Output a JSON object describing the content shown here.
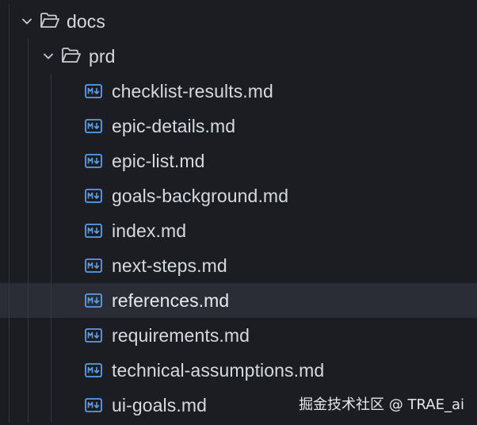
{
  "explorer": {
    "folders": [
      {
        "name": "docs",
        "expanded": true
      },
      {
        "name": "prd",
        "expanded": true
      }
    ],
    "files": [
      {
        "name": "checklist-results.md",
        "icon": "markdown-icon"
      },
      {
        "name": "epic-details.md",
        "icon": "markdown-icon"
      },
      {
        "name": "epic-list.md",
        "icon": "markdown-icon"
      },
      {
        "name": "goals-background.md",
        "icon": "markdown-icon"
      },
      {
        "name": "index.md",
        "icon": "markdown-icon"
      },
      {
        "name": "next-steps.md",
        "icon": "markdown-icon"
      },
      {
        "name": "references.md",
        "icon": "markdown-icon",
        "selected": true
      },
      {
        "name": "requirements.md",
        "icon": "markdown-icon"
      },
      {
        "name": "technical-assumptions.md",
        "icon": "markdown-icon"
      },
      {
        "name": "ui-goals.md",
        "icon": "markdown-icon"
      }
    ]
  },
  "watermark": "掘金技术社区 @ TRAE_ai",
  "colors": {
    "background": "#1b1d23",
    "selected_row": "#2a2d36",
    "text": "#d6d9de",
    "markdown_icon": "#5b9ee6",
    "indent_guide": "#33363d"
  }
}
